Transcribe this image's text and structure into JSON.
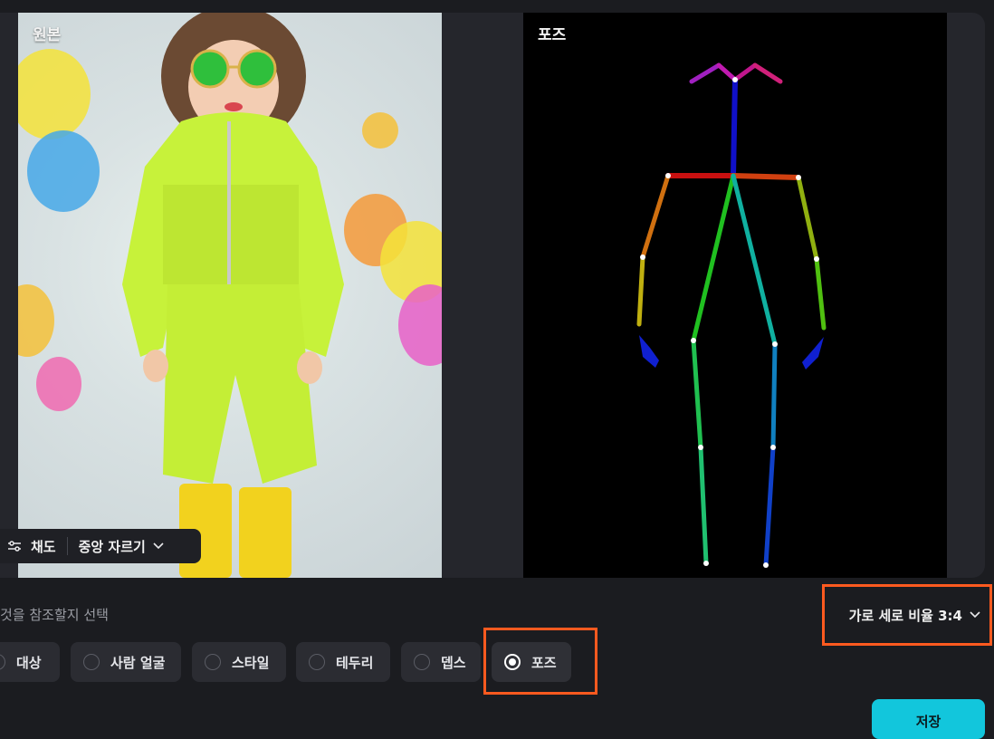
{
  "preview": {
    "source_label": "원본",
    "pose_label": "포즈"
  },
  "toolbar": {
    "saturation_label": "채도",
    "crop_label": "중앙 자르기",
    "saturation_icon": "sliders-icon",
    "crop_icon": "chevron-down-icon"
  },
  "reference": {
    "hint": "것을 참조할지 선택",
    "aspect_ratio_label": "가로 세로 비율 3:4",
    "options": [
      {
        "label": "대상",
        "selected": false
      },
      {
        "label": "사람 얼굴",
        "selected": false
      },
      {
        "label": "스타일",
        "selected": false
      },
      {
        "label": "테두리",
        "selected": false
      },
      {
        "label": "뎁스",
        "selected": false
      },
      {
        "label": "포즈",
        "selected": true
      }
    ]
  },
  "actions": {
    "save_label": "저장"
  },
  "colors": {
    "accent": "#12c6dc",
    "highlight": "#ff5a1f",
    "background": "#1b1c20"
  }
}
